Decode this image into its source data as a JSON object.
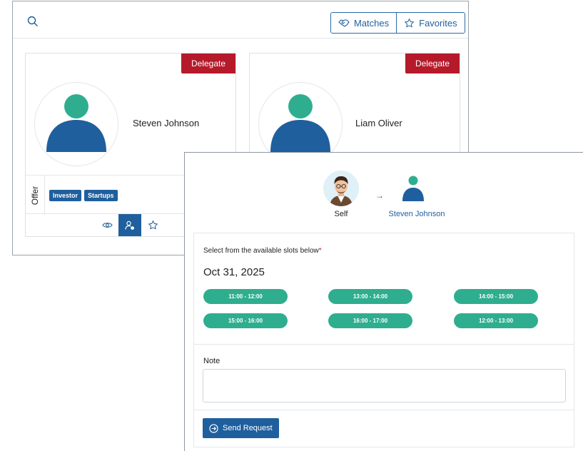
{
  "toolbar": {
    "matches_label": "Matches",
    "favorites_label": "Favorites"
  },
  "cards": [
    {
      "name": "Steven Johnson",
      "delegate_label": "Delegate",
      "offer_label": "Offer",
      "tags": [
        "Investor",
        "Startups"
      ]
    },
    {
      "name": "Liam Oliver",
      "delegate_label": "Delegate"
    }
  ],
  "modal": {
    "from_label": "Self",
    "to_label": "Steven Johnson",
    "slots_title": "Select from the available slots below",
    "required_mark": "*",
    "date": "Oct 31, 2025",
    "slots": [
      "11:00 - 12:00",
      "13:00 - 14:00",
      "14:00 - 15:00",
      "15:00 - 16:00",
      "16:00 - 17:00",
      "12:00 - 13:00"
    ],
    "note_label": "Note",
    "note_value": "",
    "send_label": "Send Request"
  },
  "colors": {
    "primary": "#1f5f9e",
    "danger": "#b51a2a",
    "slot": "#2fae8f",
    "avatar_head": "#2fae8f",
    "avatar_body": "#1f5f9e"
  }
}
